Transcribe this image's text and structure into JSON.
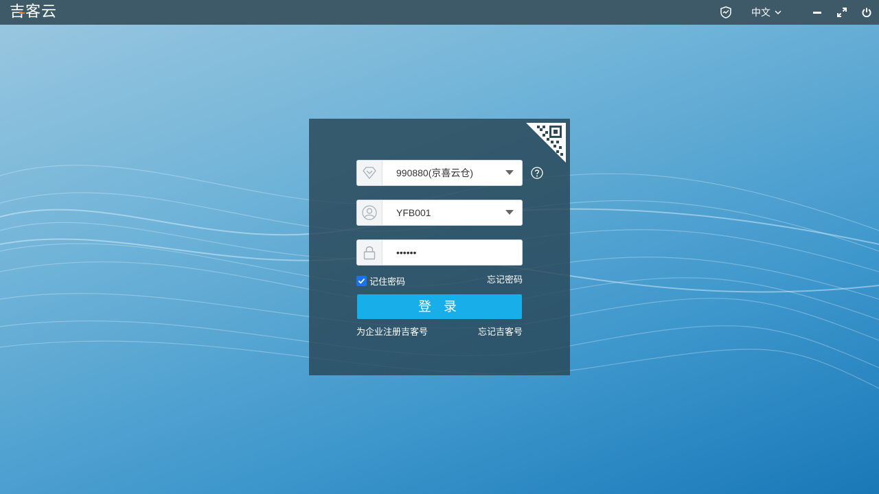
{
  "app": {
    "title": "吉客云",
    "accent_color": "#e8792b"
  },
  "titlebar": {
    "language": "中文",
    "icons": [
      "shield-icon",
      "chevron-down-icon",
      "minimize-icon",
      "maximize-icon",
      "power-icon"
    ]
  },
  "login": {
    "org_value": "990880(京喜云仓)",
    "user_value": "YFB001",
    "password_value": "••••••",
    "remember_label": "记住密码",
    "remember_checked": true,
    "forgot_password": "忘记密码",
    "login_button": "登 录",
    "register_link": "为企业注册吉客号",
    "forgot_account_link": "忘记吉客号",
    "button_color": "#17aee9"
  }
}
